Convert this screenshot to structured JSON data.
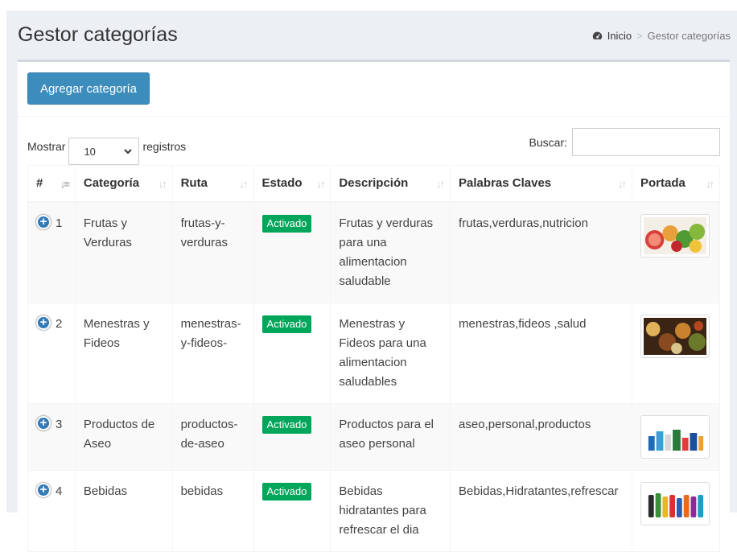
{
  "header": {
    "title": "Gestor categorías",
    "breadcrumb_home": "Inicio",
    "breadcrumb_sep": ">",
    "breadcrumb_current": "Gestor categorías"
  },
  "toolbar": {
    "add_label": "Agregar categoría"
  },
  "controls": {
    "show_label": "Mostrar",
    "page_size": "10",
    "records_label": "registros",
    "search_label": "Buscar:",
    "search_value": ""
  },
  "table": {
    "columns": [
      "#",
      "Categoría",
      "Ruta",
      "Estado",
      "Descripción",
      "Palabras Claves",
      "Portada"
    ],
    "rows": [
      {
        "num": "1",
        "categoria": "Frutas y Verduras",
        "ruta": "frutas-y-verduras",
        "estado": "Activado",
        "descripcion": "Frutas y verduras para una alimentacion saludable",
        "palabras": "frutas,verduras,nutricion",
        "portada": "frutas-verduras-image"
      },
      {
        "num": "2",
        "categoria": "Menestras y Fideos",
        "ruta": "menestras-y-fideos-",
        "estado": "Activado",
        "descripcion": "Menestras y Fideos para una alimentacion saludables",
        "palabras": "menestras,fideos ,salud",
        "portada": "menestras-fideos-image"
      },
      {
        "num": "3",
        "categoria": "Productos de Aseo",
        "ruta": "productos-de-aseo",
        "estado": "Activado",
        "descripcion": "Productos para el aseo personal",
        "palabras": "aseo,personal,productos",
        "portada": "productos-aseo-image"
      },
      {
        "num": "4",
        "categoria": "Bebidas",
        "ruta": "bebidas",
        "estado": "Activado",
        "descripcion": "Bebidas hidratantes para refrescar el dia",
        "palabras": "Bebidas,Hidratantes,refrescar",
        "portada": "bebidas-image"
      }
    ]
  },
  "colors": {
    "primary": "#3c8dbc",
    "success": "#00a65a",
    "expand": "#337ab7"
  }
}
